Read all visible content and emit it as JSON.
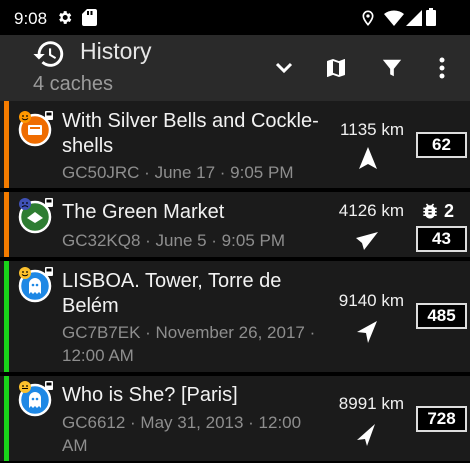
{
  "status_bar": {
    "time": "9:08"
  },
  "app_bar": {
    "title": "History",
    "subtitle": "4 caches"
  },
  "caches": [
    {
      "title": "With Silver Bells and Cockle-shells",
      "subtitle": "GC50JRC · June 17 · 9:05 PM",
      "distance": "1135 km",
      "count": "62",
      "stripe_color": "#f57c00",
      "cache_color": "#ef6c00",
      "face": "smile-orange"
    },
    {
      "title": "The Green Market",
      "subtitle": "GC32KQ8 · June 5 · 9:05 PM",
      "distance": "4126 km",
      "count": "43",
      "trackables": "2",
      "stripe_color": "#f57c00",
      "cache_color": "#2e7d32",
      "face": "sad-blue"
    },
    {
      "title": "LISBOA. Tower, Torre de Belém",
      "subtitle": "GC7B7EK · November 26, 2017 · 12:00 AM",
      "distance": "9140 km",
      "count": "485",
      "stripe_color": "#19d319",
      "cache_color": "#1e88e5",
      "face": "smile-yellow"
    },
    {
      "title": "Who is She? [Paris]",
      "subtitle": "GC6612 · May 31, 2013 · 12:00 AM",
      "distance": "8991 km",
      "count": "728",
      "stripe_color": "#19d319",
      "cache_color": "#1e88e5",
      "face": "smile-yellow"
    }
  ],
  "icons": {
    "history": "history-icon",
    "expand": "chevron-down-icon",
    "map": "map-icon",
    "filter": "filter-icon",
    "more": "more-vert-icon",
    "location": "location-pin-icon",
    "wifi": "wifi-icon",
    "signal": "signal-icon",
    "battery": "battery-icon",
    "settings": "gear-icon",
    "sdcard": "sd-card-icon"
  }
}
